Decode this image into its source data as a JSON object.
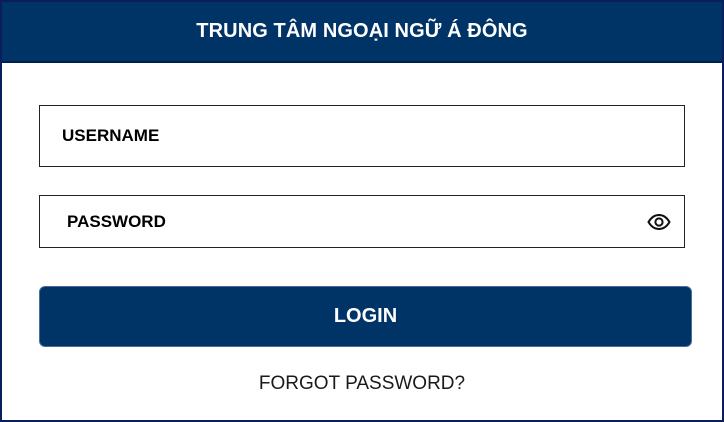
{
  "header": {
    "title": "TRUNG TÂM NGOẠI NGỮ Á ĐÔNG"
  },
  "form": {
    "username": {
      "placeholder": "USERNAME",
      "value": ""
    },
    "password": {
      "placeholder": "PASSWORD",
      "value": "",
      "toggle_icon": "eye-icon"
    },
    "login_label": "LOGIN",
    "forgot_label": "FORGOT PASSWORD?"
  },
  "colors": {
    "brand": "#003366",
    "border": "#0a1d5c"
  }
}
